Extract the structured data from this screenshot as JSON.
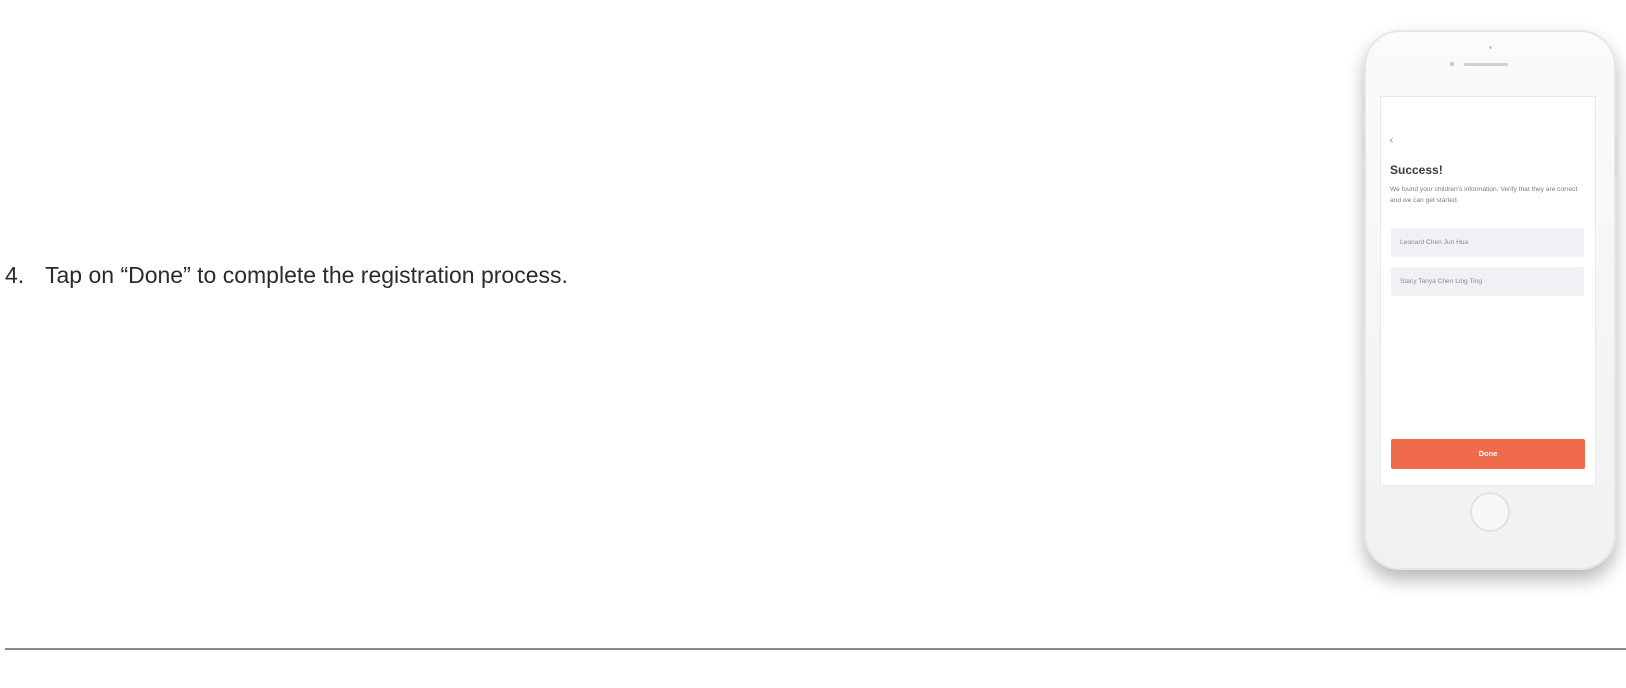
{
  "instruction": {
    "number": "4.",
    "text": "Tap on “Done” to complete the registration process."
  },
  "phone_screen": {
    "back_icon": "chevron-left-icon",
    "back_glyph": "‹",
    "title": "Success!",
    "description": "We found your children's information. Verify that they are correct and we can get started.",
    "children": [
      "Leonard Chen Jun Hua",
      "Stacy Tanya Chen Ling Ting"
    ],
    "done_label": "Done"
  },
  "colors": {
    "accent": "#f06a4c",
    "field_background": "#eff1f5",
    "text": "#2b2b2b",
    "divider": "#8a8a8a"
  }
}
